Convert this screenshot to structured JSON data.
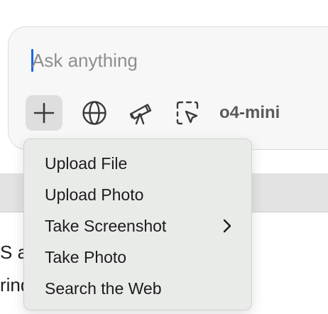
{
  "composer": {
    "placeholder": "Ask anything",
    "tools": [
      {
        "name": "plus-icon"
      },
      {
        "name": "globe-icon"
      },
      {
        "name": "telescope-icon"
      },
      {
        "name": "select-region-icon"
      }
    ],
    "model_label": "o4-mini"
  },
  "menu": {
    "items": [
      {
        "label": "Upload File"
      },
      {
        "label": "Upload Photo"
      },
      {
        "label": "Take Screenshot",
        "submenu_icon": "chevron-right-icon"
      },
      {
        "label": "Take Photo"
      },
      {
        "label": "Search the Web"
      }
    ]
  },
  "background": {
    "line1": "S app e",
    "line2": "rindow y"
  },
  "colors": {
    "caret": "#1a66e6",
    "menu_bg": "#e9ebe9",
    "composer_bg": "#f7f7f7"
  }
}
